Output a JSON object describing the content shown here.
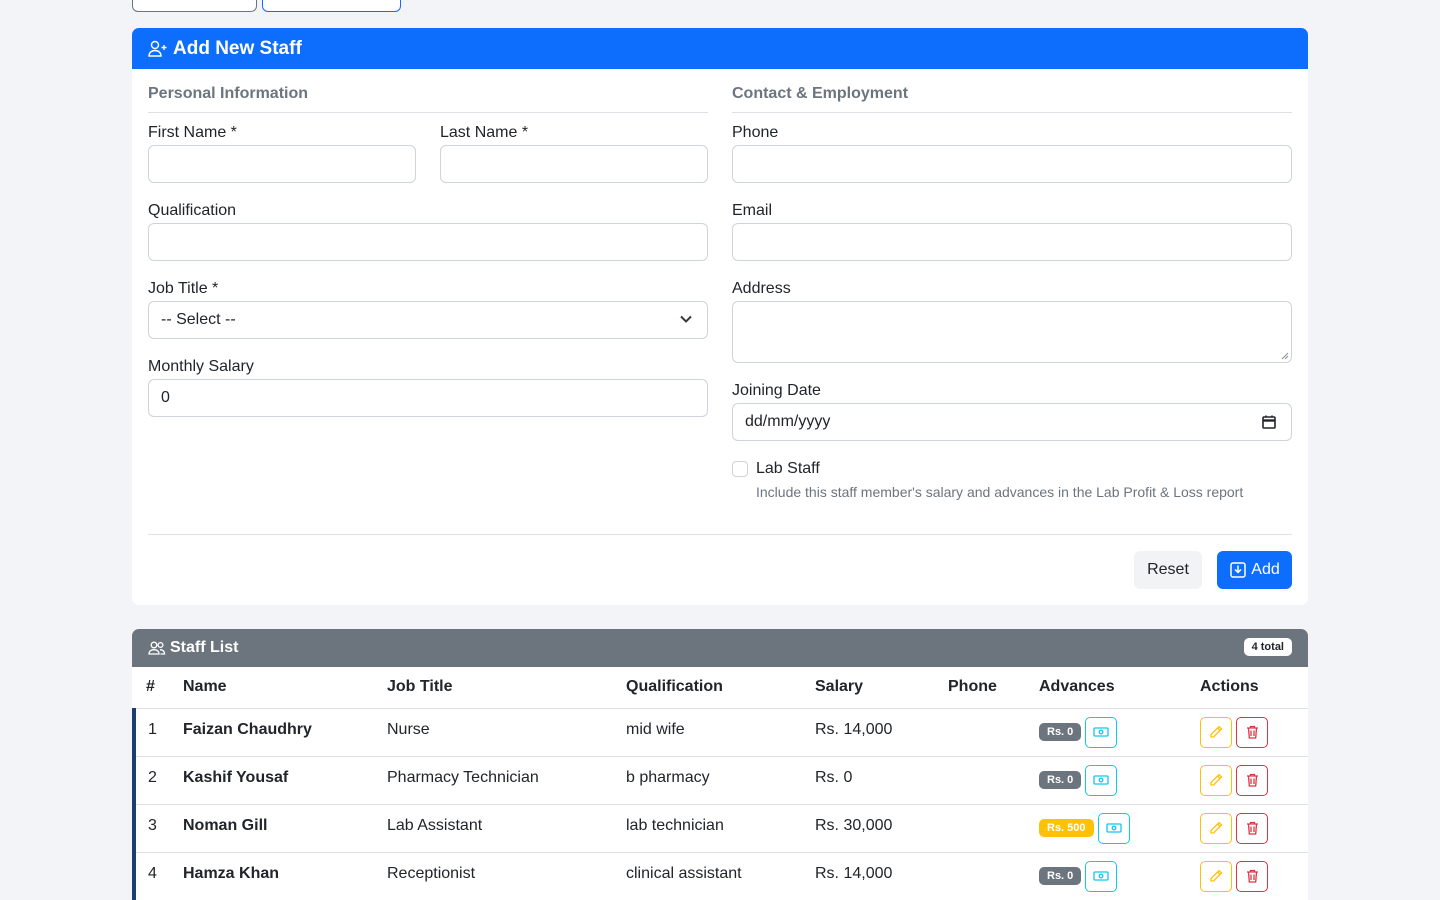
{
  "form": {
    "title": "Add New Staff",
    "personal_section": "Personal Information",
    "contact_section": "Contact & Employment",
    "first_name_label": "First Name *",
    "last_name_label": "Last Name *",
    "qualification_label": "Qualification",
    "job_title_label": "Job Title *",
    "job_title_value": "-- Select --",
    "monthly_salary_label": "Monthly Salary",
    "monthly_salary_value": "0",
    "phone_label": "Phone",
    "email_label": "Email",
    "address_label": "Address",
    "joining_date_label": "Joining Date",
    "joining_date_value": "dd/mm/yyyy",
    "lab_staff_label": "Lab Staff",
    "lab_staff_help": "Include this staff member's salary and advances in the Lab Profit & Loss report",
    "reset_label": "Reset",
    "add_label": "Add"
  },
  "staff_list": {
    "title": "Staff List",
    "total_badge": "4 total",
    "columns": [
      "#",
      "Name",
      "Job Title",
      "Qualification",
      "Salary",
      "Phone",
      "Advances",
      "Actions"
    ],
    "rows": [
      {
        "num": "1",
        "name": "Faizan Chaudhry",
        "job": "Nurse",
        "qualification": "mid wife",
        "salary": "Rs. 14,000",
        "phone": "",
        "advance": "Rs. 0",
        "advance_status": "none"
      },
      {
        "num": "2",
        "name": "Kashif Yousaf",
        "job": "Pharmacy Technician",
        "qualification": "b pharmacy",
        "salary": "Rs. 0",
        "phone": "",
        "advance": "Rs. 0",
        "advance_status": "none"
      },
      {
        "num": "3",
        "name": "Noman Gill",
        "job": "Lab Assistant",
        "qualification": "lab technician",
        "salary": "Rs. 30,000",
        "phone": "",
        "advance": "Rs. 500",
        "advance_status": "warn"
      },
      {
        "num": "4",
        "name": "Hamza Khan",
        "job": "Receptionist",
        "qualification": "clinical assistant",
        "salary": "Rs. 14,000",
        "phone": "",
        "advance": "Rs. 0",
        "advance_status": "none"
      }
    ]
  },
  "colors": {
    "primary": "#0d6efd",
    "secondary": "#6c757d",
    "info": "#0dcaf0",
    "warning": "#ffc107",
    "danger": "#dc3545"
  }
}
